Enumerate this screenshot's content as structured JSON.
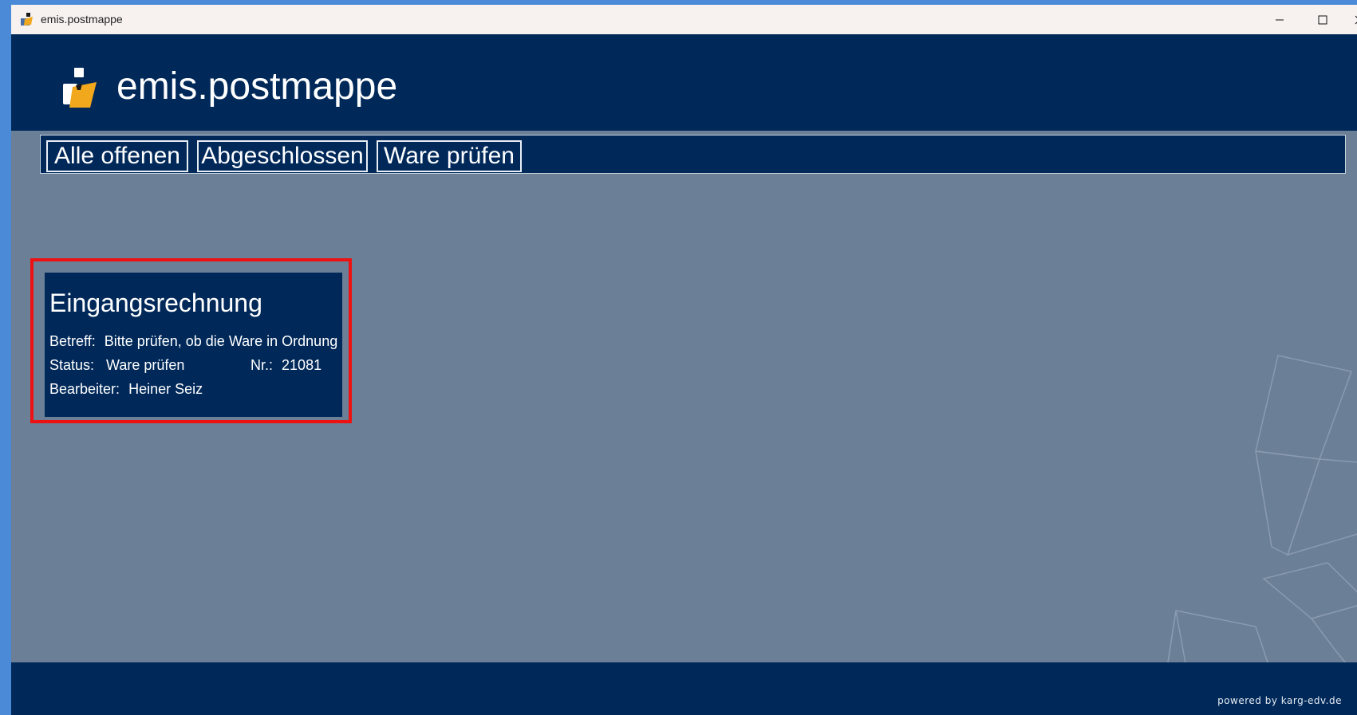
{
  "window": {
    "title": "emis.postmappe"
  },
  "header": {
    "app_name": "emis.postmappe"
  },
  "tabs": [
    {
      "label": "Alle offenen"
    },
    {
      "label": "Abgeschlossen"
    },
    {
      "label": "Ware prüfen"
    }
  ],
  "card": {
    "title": "Eingangsrechnung",
    "subject_label": "Betreff:",
    "subject_value": "Bitte prüfen, ob die Ware in Ordnung",
    "status_label": "Status:",
    "status_value": "Ware prüfen",
    "number_label": "Nr.:",
    "number_value": "21081",
    "editor_label": "Bearbeiter:",
    "editor_value": "Heiner Seiz"
  },
  "footer": {
    "powered_by": "powered by karg-edv.de"
  },
  "colors": {
    "navy": "#00295a",
    "background": "#6b7f96",
    "highlight": "#ee1111"
  }
}
